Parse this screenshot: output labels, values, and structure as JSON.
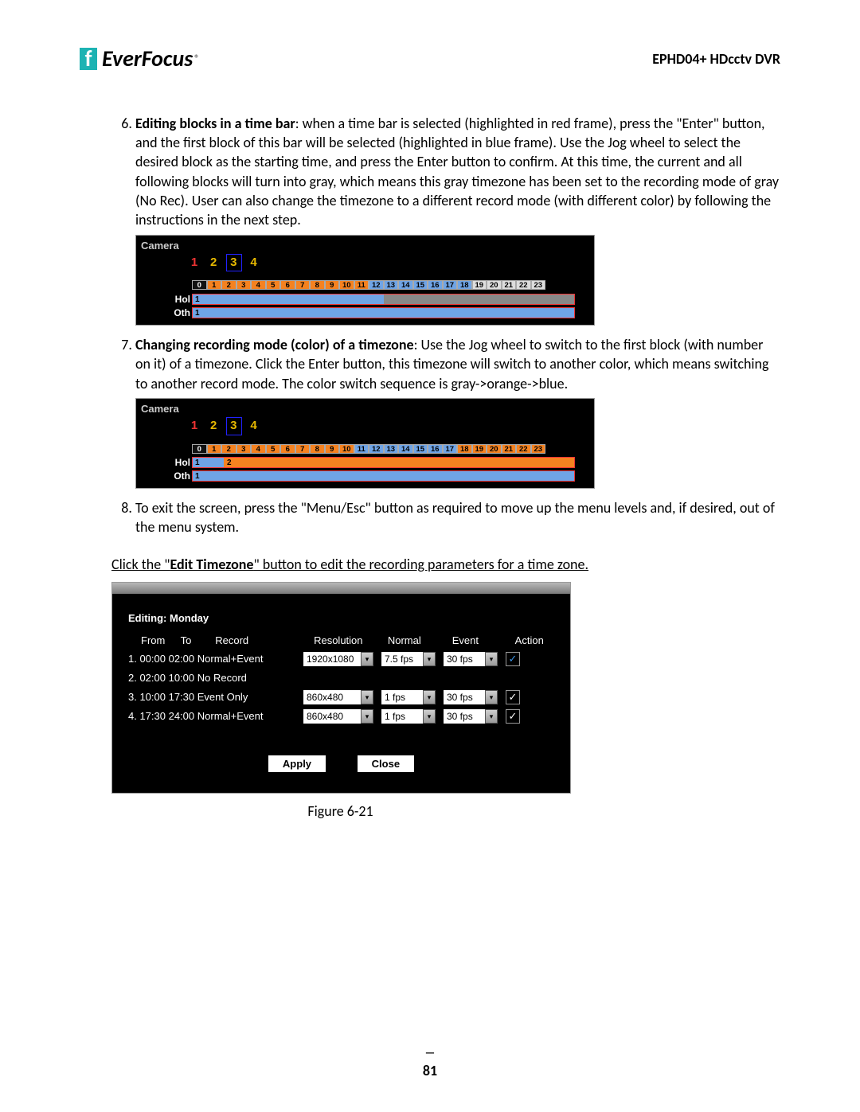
{
  "header": {
    "brand_prefix": "Ever",
    "brand_suffix": "Focus",
    "product": "EPHD04+  HDcctv DVR"
  },
  "list_start": 6,
  "items": {
    "i6_title": "Editing blocks in a time bar",
    "i6_body": ": when a time bar is selected (highlighted in red frame), press the \"Enter\" button, and the first block of this bar will be selected (highlighted in blue frame). Use the Jog wheel to select the desired block as the starting time, and press the Enter button to confirm. At this time, the current and all following blocks will turn into gray, which means this gray timezone has been set to the recording mode of gray (No Rec).  User can also change the timezone to a different record mode (with different color) by following the instructions in the next step.",
    "i7_title": "Changing recording mode (color) of a timezone",
    "i7_body": ": Use the Jog wheel to switch to the first block (with number on it) of a timezone. Click the Enter button, this timezone will switch to another color, which means switching to another record mode. The color switch sequence is gray->orange->blue.",
    "i8_body": "To exit the screen, press the \"Menu/Esc\" button as required to move up the menu levels and, if desired, out of the menu system."
  },
  "camera_block": {
    "label": "Camera",
    "cams": [
      "1",
      "2",
      "3",
      "4"
    ],
    "selected_cam_index": 2,
    "hours": [
      "0",
      "1",
      "2",
      "3",
      "4",
      "5",
      "6",
      "7",
      "8",
      "9",
      "10",
      "11",
      "12",
      "13",
      "14",
      "15",
      "16",
      "17",
      "18",
      "19",
      "20",
      "21",
      "22",
      "23"
    ],
    "row_hol": "Hol",
    "row_oth": "Oth"
  },
  "edit_tz_line": {
    "prefix": "Click the \"",
    "bold": "Edit Timezone",
    "suffix": "\" button to edit the recording parameters for a time zone."
  },
  "edit_panel": {
    "title": "Editing: Monday",
    "cols": {
      "from": "From",
      "to": "To",
      "record": "Record",
      "resolution": "Resolution",
      "normal": "Normal",
      "event": "Event",
      "action": "Action"
    },
    "rows": [
      {
        "label": "1. 00:00 02:00  Normal+Event",
        "resolution": "1920x1080",
        "normal": "7.5 fps",
        "event": "30 fps",
        "action_checked": true,
        "action_blue": true
      },
      {
        "label": "2. 02:00 10:00  No Record",
        "resolution": "",
        "normal": "",
        "event": "",
        "action_checked": false
      },
      {
        "label": "3. 10:00 17:30  Event Only",
        "resolution": "860x480",
        "normal": "1 fps",
        "event": "30 fps",
        "action_checked": true
      },
      {
        "label": "4. 17:30 24:00  Normal+Event",
        "resolution": "860x480",
        "normal": "1 fps",
        "event": "30 fps",
        "action_checked": true
      }
    ],
    "apply": "Apply",
    "close": "Close"
  },
  "figure_caption": "Figure 6-21",
  "page_number": "81"
}
